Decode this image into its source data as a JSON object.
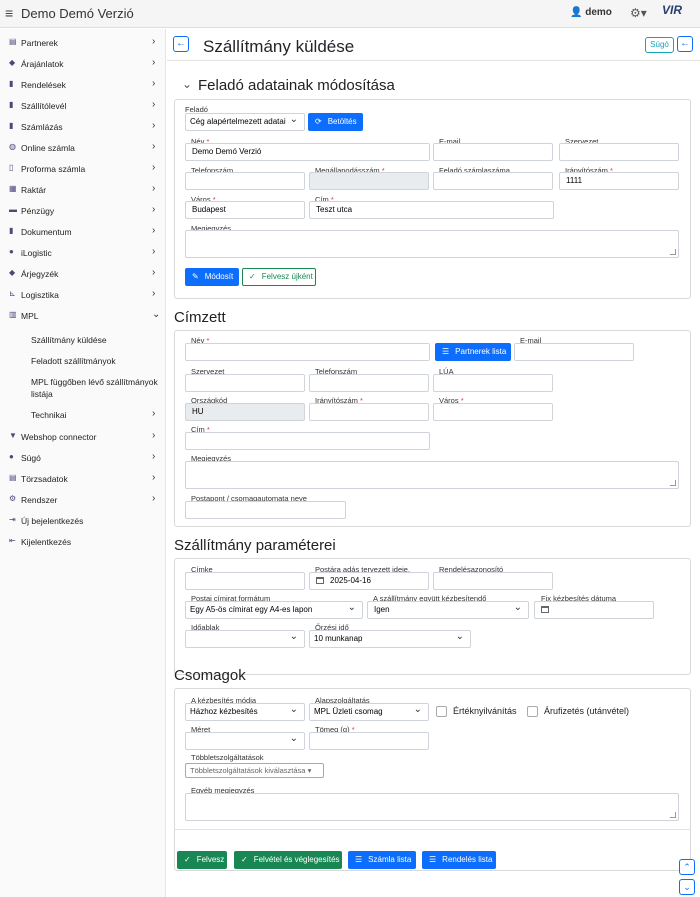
{
  "app": {
    "title": "Demo Demó Verzió",
    "user": "demo",
    "logo": "VIR"
  },
  "sidebar": {
    "items": [
      {
        "label": "Partnerek",
        "icon": "id-card-icon"
      },
      {
        "label": "Árajánlatok",
        "icon": "handshake-icon"
      },
      {
        "label": "Rendelések",
        "icon": "file-icon"
      },
      {
        "label": "Szállítólevél",
        "icon": "clipboard-icon"
      },
      {
        "label": "Számlázás",
        "icon": "file-invoice-icon"
      },
      {
        "label": "Online számla",
        "icon": "globe-icon"
      },
      {
        "label": "Proforma számla",
        "icon": "document-icon"
      },
      {
        "label": "Raktár",
        "icon": "warehouse-icon"
      },
      {
        "label": "Pénzügy",
        "icon": "money-icon"
      },
      {
        "label": "Dokumentum",
        "icon": "folder-icon"
      },
      {
        "label": "iLogistic",
        "icon": "box-icon"
      },
      {
        "label": "Árjegyzék",
        "icon": "tag-icon"
      },
      {
        "label": "Logisztika",
        "icon": "dolly-icon"
      },
      {
        "label": "MPL",
        "icon": "mail-box-icon"
      }
    ],
    "mpl_sub": [
      "Szállítmány küldése",
      "Feladott szállítmányok",
      "MPL függőben lévő szállítmányok",
      "listája",
      "Technikai"
    ],
    "items2": [
      {
        "label": "Webshop connector",
        "icon": "cart-icon"
      },
      {
        "label": "Súgó",
        "icon": "question-icon"
      },
      {
        "label": "Törzsadatok",
        "icon": "database-icon"
      },
      {
        "label": "Rendszer",
        "icon": "cogs-icon"
      },
      {
        "label": "Új bejelentkezés",
        "icon": "login-icon"
      },
      {
        "label": "Kijelentkezés",
        "icon": "logout-icon"
      }
    ]
  },
  "page": {
    "title": "Szállítmány küldése",
    "help": "Súgó"
  },
  "sender": {
    "title": "Feladó adatainak módosítása",
    "felado_label": "Feladó",
    "felado_value": "Cég alapértelmezett adatai",
    "load_btn": "Betöltés",
    "nev_label": "Név",
    "nev_value": "Demo Demó Verzió",
    "email_label": "E-mail",
    "szervezet_label": "Szervezet",
    "telefon_label": "Telefonszám",
    "megall_label": "Megállapodásszám",
    "szamlaszam_label": "Feladó számlaszáma",
    "irsz_label": "Irányítószám",
    "irsz_value": "1111",
    "varos_label": "Város",
    "varos_value": "Budapest",
    "cim_label": "Cím",
    "cim_value": "Teszt utca",
    "megj_label": "Megjegyzés",
    "modify_btn": "Módosít",
    "save_new_btn": "Felvesz újként"
  },
  "recipient": {
    "title": "Címzett",
    "nev_label": "Név",
    "partners_btn": "Partnerek lista",
    "email_label": "E-mail",
    "szervezet_label": "Szervezet",
    "telefon_label": "Telefonszám",
    "lua_label": "LÚA",
    "orszag_label": "Országkód",
    "orszag_value": "HU",
    "irsz_label": "Irányítószám",
    "varos_label": "Város",
    "cim_label": "Cím",
    "megj_label": "Megjegyzés",
    "postapont_label": "Postapont / csomagautomata neve"
  },
  "params": {
    "title": "Szállítmány paraméterei",
    "cimke_label": "Címke",
    "datum_label": "Postára adás tervezett ideje.",
    "datum_value": "2025-04-16",
    "rendeles_label": "Rendelésazonosító",
    "format_label": "Postai címirat formátum",
    "format_value": "Egy A5-ös címirat egy A4-es lapon",
    "egyutt_label": "A szállítmány együtt kézbesítendő",
    "egyutt_value": "Igen",
    "fix_label": "Fix kézbesítés dátuma",
    "idoablak_label": "Időablak",
    "orzes_label": "Őrzési idő",
    "orzes_value": "10 munkanap"
  },
  "packages": {
    "title": "Csomagok",
    "mod_label": "A kézbesítés módja",
    "mod_value": "Házhoz kézbesítés",
    "alap_label": "Alapszolgáltatás",
    "alap_value": "MPL Üzleti csomag",
    "ertek_label": "Értéknyilvánítás",
    "arufiz_label": "Árufizetés (utánvétel)",
    "meret_label": "Méret",
    "tomeg_label": "Tömeg (g)",
    "tobb_label": "Többletszolgáltatások",
    "tobb_placeholder": "Többletszolgáltatások kiválasztása",
    "egyeb_label": "Egyéb megjegyzés"
  },
  "footer": {
    "felvesz": "Felvesz",
    "felvetel_veg": "Felvétel és véglegesítés",
    "szamla_lista": "Számla lista",
    "rendeles_lista": "Rendelés lista"
  },
  "colors": {
    "primary": "#0d6efd",
    "success": "#198754",
    "info": "#17a2b8",
    "danger": "#dc3545"
  }
}
